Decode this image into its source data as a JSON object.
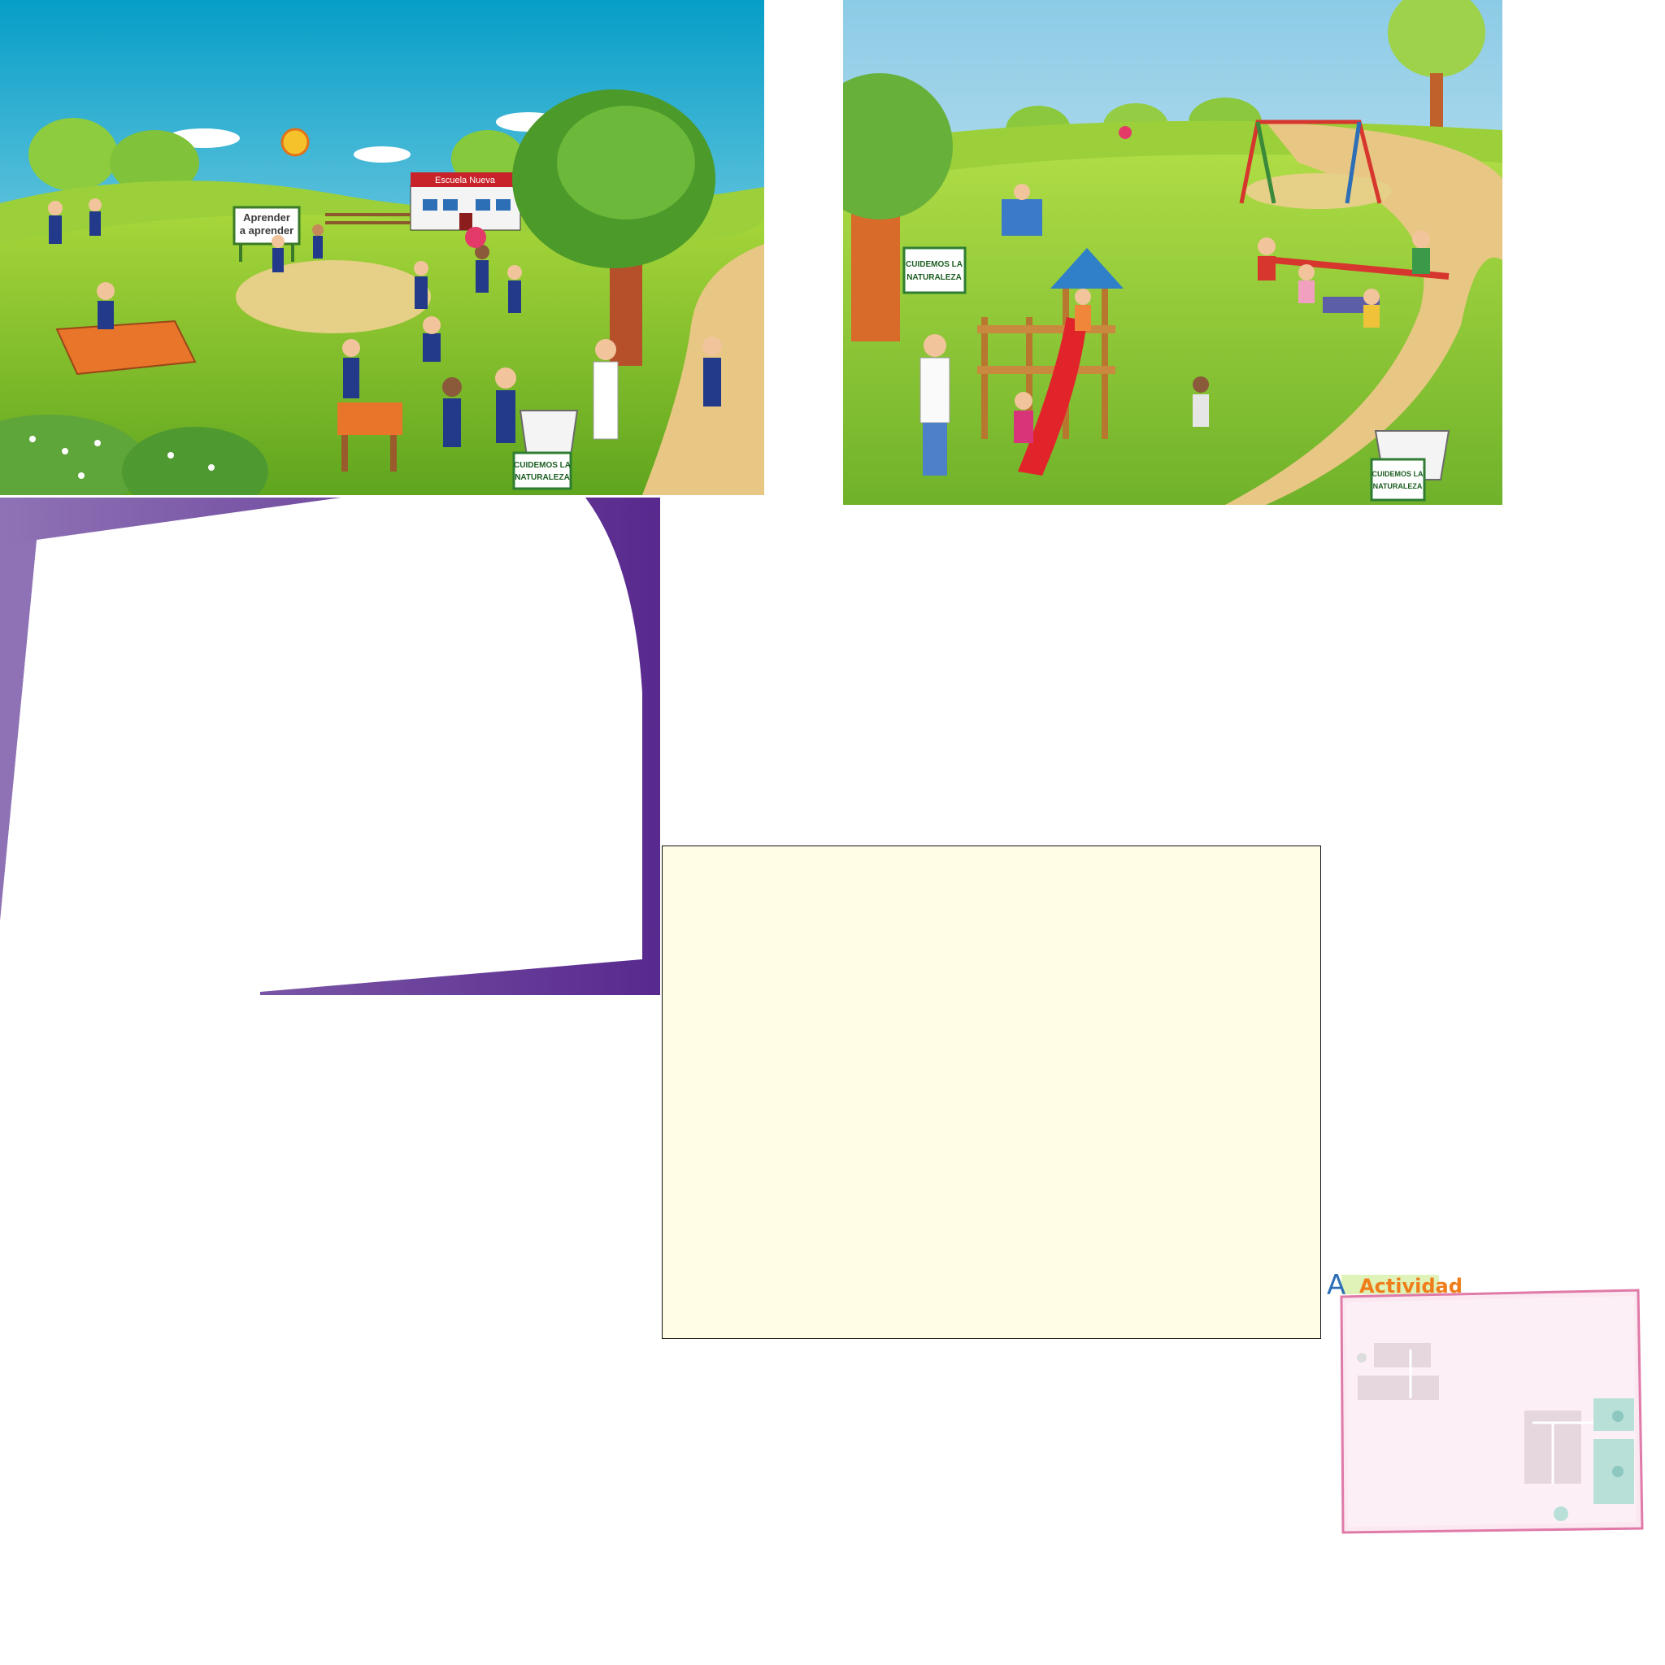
{
  "school_scene": {
    "building_sign": "Escuela Nueva",
    "motto_sign_line1": "Aprender",
    "motto_sign_line2": "a aprender",
    "nature_sign_line1": "CUIDEMOS LA",
    "nature_sign_line2": "NATURALEZA"
  },
  "park_scene": {
    "tree_sign_line1": "CUIDEMOS LA",
    "tree_sign_line2": "NATURALEZA",
    "bin_sign_line1": "CUIDEMOS LA",
    "bin_sign_line2": "NATURALEZA"
  },
  "activity": {
    "initial": "A",
    "title": "Actividad"
  },
  "colors": {
    "sky_top": "#0aa0c8",
    "grass": "#7dbf2a",
    "purple": "#5b2c8f",
    "note_bg": "#fffde6",
    "activity_pink": "#e07aa8"
  }
}
